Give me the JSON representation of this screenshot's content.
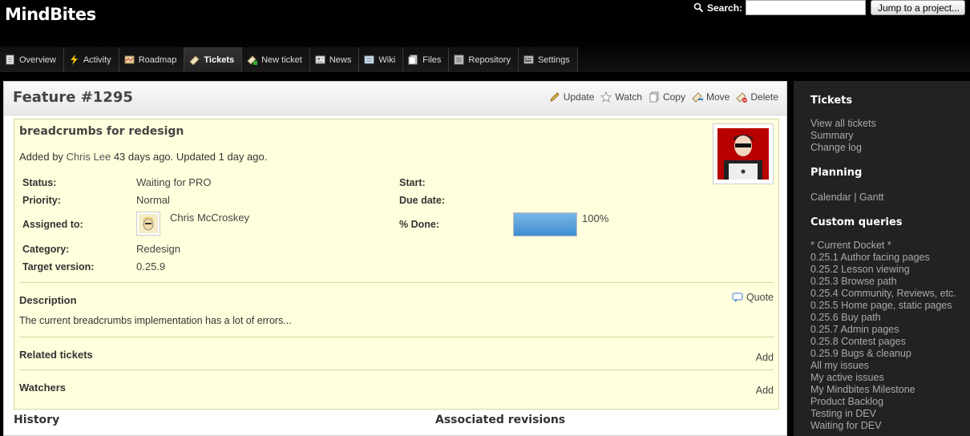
{
  "app": {
    "logo": "MindBites"
  },
  "search": {
    "label": "Search:",
    "value": "",
    "jump_label": "Jump to a project..."
  },
  "tabs": [
    {
      "label": "Overview",
      "icon": "overview-icon",
      "active": false
    },
    {
      "label": "Activity",
      "icon": "activity-icon",
      "active": false
    },
    {
      "label": "Roadmap",
      "icon": "roadmap-icon",
      "active": false
    },
    {
      "label": "Tickets",
      "icon": "tickets-icon",
      "active": true
    },
    {
      "label": "New ticket",
      "icon": "new-ticket-icon",
      "active": false
    },
    {
      "label": "News",
      "icon": "news-icon",
      "active": false
    },
    {
      "label": "Wiki",
      "icon": "wiki-icon",
      "active": false
    },
    {
      "label": "Files",
      "icon": "files-icon",
      "active": false
    },
    {
      "label": "Repository",
      "icon": "repository-icon",
      "active": false
    },
    {
      "label": "Settings",
      "icon": "settings-icon",
      "active": false
    }
  ],
  "page": {
    "title": "Feature #1295"
  },
  "actions": {
    "update": "Update",
    "watch": "Watch",
    "copy": "Copy",
    "move": "Move",
    "delete": "Delete"
  },
  "issue": {
    "subject": "breadcrumbs for redesign",
    "added_by_prefix": "Added by",
    "author": "Chris Lee",
    "added_suffix": "43 days ago. Updated 1 day ago.",
    "status_label": "Status:",
    "status": "Waiting for PRO",
    "priority_label": "Priority:",
    "priority": "Normal",
    "assigned_label": "Assigned to:",
    "assigned": "Chris McCroskey",
    "category_label": "Category:",
    "category": "Redesign",
    "target_label": "Target version:",
    "target": "0.25.9",
    "start_label": "Start:",
    "due_label": "Due date:",
    "done_label": "% Done:",
    "done_text": "100%",
    "done_fraction": 1.0,
    "description_title": "Description",
    "quote": "Quote",
    "description": "The current breadcrumbs implementation has a lot of errors...",
    "related_title": "Related tickets",
    "related_add": "Add",
    "watchers_title": "Watchers",
    "watchers_add": "Add"
  },
  "lower": {
    "history": "History",
    "revisions": "Associated revisions"
  },
  "sidebar": {
    "tickets_title": "Tickets",
    "tickets_links": [
      "View all tickets",
      "Summary",
      "Change log"
    ],
    "planning_title": "Planning",
    "calendar": "Calendar",
    "planning_sep": "|",
    "gantt": "Gantt",
    "queries_title": "Custom queries",
    "queries": [
      "* Current Docket *",
      "0.25.1 Author facing pages",
      "0.25.2 Lesson viewing",
      "0.25.3 Browse path",
      "0.25.4 Community, Reviews, etc.",
      "0.25.5 Home page, static pages",
      "0.25.6 Buy path",
      "0.25.7 Admin pages",
      "0.25.8 Contest pages",
      "0.25.9 Bugs & cleanup",
      "All my issues",
      "My active issues",
      "My Mindbites Milestone",
      "Product Backlog",
      "Testing in DEV",
      "Waiting for DEV"
    ]
  },
  "colors": {
    "progress": "#4a98d8",
    "issue_bg": "#ffffdd",
    "sidebar_bg": "#222222"
  }
}
